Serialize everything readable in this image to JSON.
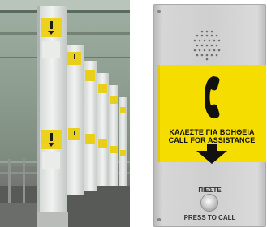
{
  "photo": {
    "description_icon": "roadside-emergency-phone-columns-photo"
  },
  "panel": {
    "greek_label": "ΚΑΛΕΣΤΕ ΓΙΑ ΒΟΗΘΕΙΑ",
    "english_label": "CALL FOR ASSISTANCE",
    "push_greek": "ΠΙΕΣΤΕ",
    "push_english": "PRESS TO CALL",
    "colors": {
      "yellow": "#f6dd00",
      "steel": "#d0d0d0",
      "ink": "#111111"
    },
    "icons": [
      "speaker-grille-icon",
      "telephone-handset-icon",
      "arrow-down-icon",
      "call-button-icon"
    ]
  }
}
